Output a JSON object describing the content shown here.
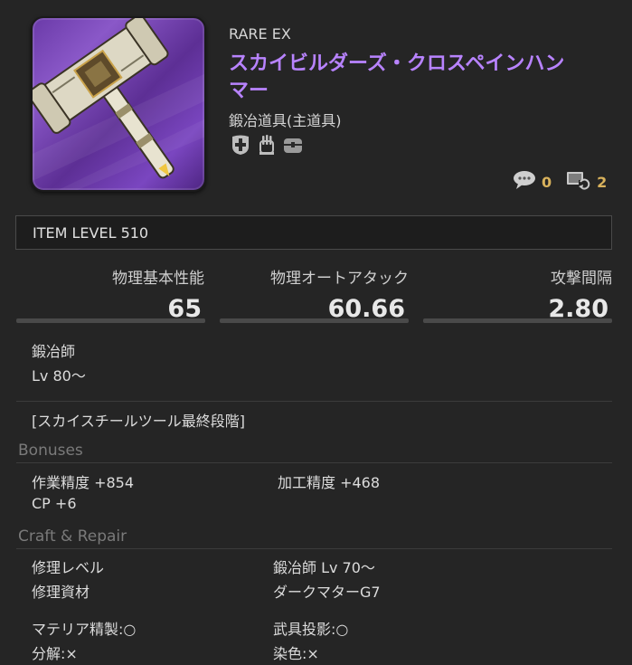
{
  "item": {
    "rarity": "RARE EX",
    "name": "スカイビルダーズ・クロスペインハンマー",
    "type": "鍛冶道具(主道具)",
    "type_icons": [
      "repair-cross-icon",
      "hand-icon",
      "chest-icon"
    ],
    "comment_count": "0",
    "sync_count": "2"
  },
  "item_level": "ITEM LEVEL 510",
  "stats": [
    {
      "label": "物理基本性能",
      "value": "65"
    },
    {
      "label": "物理オートアタック",
      "value": "60.66"
    },
    {
      "label": "攻撃間隔",
      "value": "2.80"
    }
  ],
  "class_job": {
    "name": "鍛冶師",
    "level": "Lv 80〜"
  },
  "item_series": "[スカイスチールツール最終段階]",
  "bonuses": {
    "heading": "Bonuses",
    "items": [
      "作業精度 +854",
      "加工精度 +468",
      "CP +6"
    ]
  },
  "craft_repair": {
    "heading": "Craft & Repair",
    "repair_level_label": "修理レベル",
    "repair_level_value": "鍛冶師 Lv 70〜",
    "repair_material_label": "修理資材",
    "repair_material_value": "ダークマターG7",
    "materia_meld": "マテリア精製:○",
    "glamour": "武具投影:○",
    "desynth": "分解:×",
    "dye": "染色:×"
  },
  "colors": {
    "name": "#b883ff",
    "counter": "#d9b25c",
    "background": "#252525"
  }
}
